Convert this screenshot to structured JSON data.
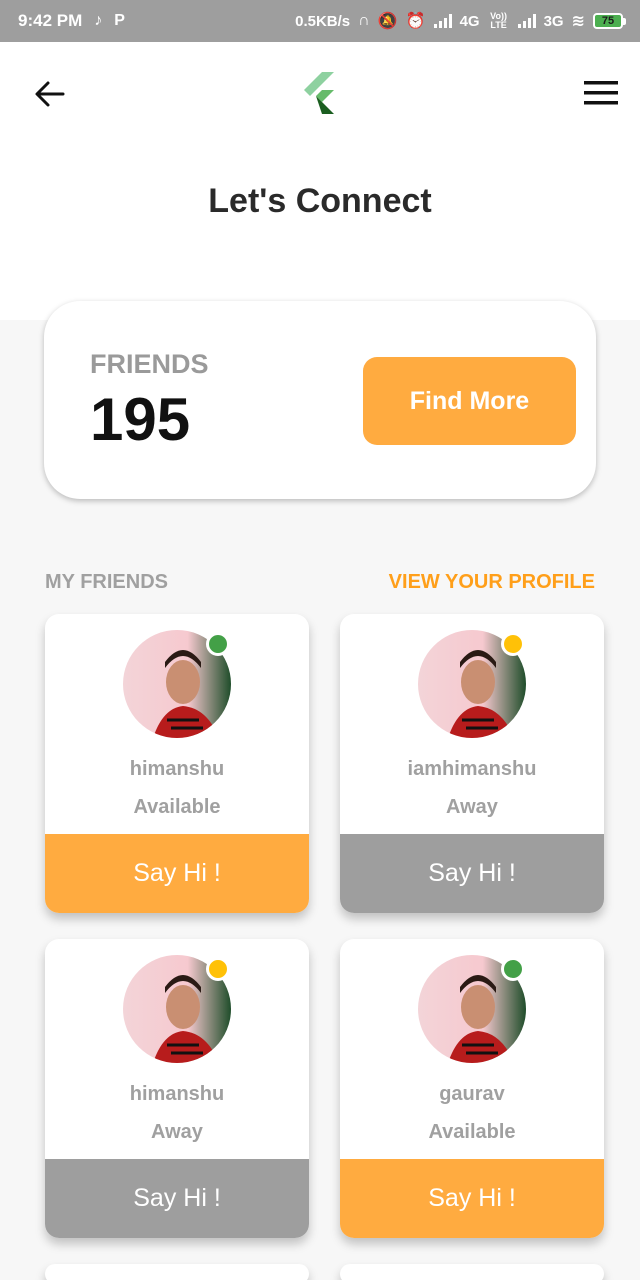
{
  "status_bar": {
    "time": "9:42 PM",
    "speed": "0.5KB/s",
    "network1": "4G",
    "volte": "Vo)) LTE",
    "network2": "3G",
    "battery": "75"
  },
  "header": {
    "title": "Let's Connect",
    "back_icon": "arrow-left-icon",
    "menu_icon": "hamburger-menu-icon",
    "logo_icon": "flutter-logo-icon"
  },
  "summary": {
    "friends_label": "FRIENDS",
    "friends_count": "195",
    "find_more_label": "Find More"
  },
  "section": {
    "my_friends": "MY FRIENDS",
    "view_profile": "VIEW YOUR PROFILE"
  },
  "friends": [
    {
      "name": "himanshu",
      "status": "Available",
      "button": "Say Hi !"
    },
    {
      "name": "iamhimanshu",
      "status": "Away",
      "button": "Say Hi !"
    },
    {
      "name": "himanshu",
      "status": "Away",
      "button": "Say Hi !"
    },
    {
      "name": "gaurav",
      "status": "Available",
      "button": "Say Hi !"
    }
  ],
  "colors": {
    "accent": "#ffab40",
    "link": "#ff9f1a",
    "available": "#43a047",
    "away": "#ffc107",
    "inactive_button": "#9e9e9e"
  }
}
